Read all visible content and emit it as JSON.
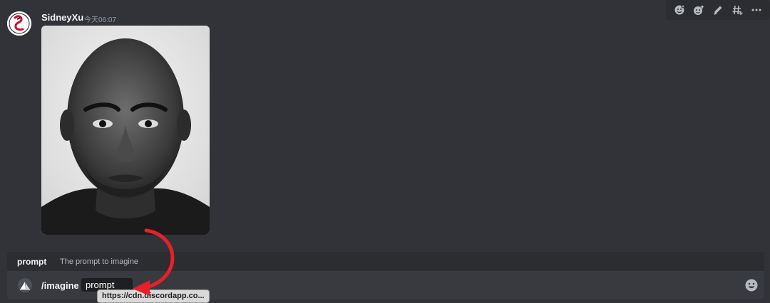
{
  "message": {
    "username": "SidneyXu",
    "timestamp": "今天06:07",
    "attachment_alt": "black and white portrait photo"
  },
  "toolbar": {
    "buttons": [
      "add-reaction",
      "super-reaction",
      "edit",
      "create-thread",
      "more"
    ]
  },
  "command_option": {
    "name": "prompt",
    "description": "The prompt to imagine"
  },
  "composer": {
    "command": "/imagine",
    "parameter": "prompt"
  },
  "tooltip": {
    "url": "https://cdn.discordapp.co..."
  },
  "colors": {
    "background": "#313338",
    "panel": "#2b2d31",
    "composer": "#383a40",
    "arrow": "#e8202a"
  }
}
